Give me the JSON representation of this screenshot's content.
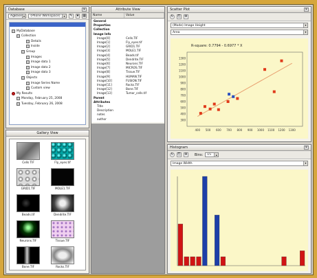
{
  "left_panel": {
    "title": "Database",
    "db_combo": "AgBase",
    "image_combo": "(Phone Workspace)"
  },
  "tree": {
    "items": [
      {
        "label": "MyDatabase",
        "level": 0
      },
      {
        "label": "Collection",
        "level": 1
      },
      {
        "label": "Details",
        "level": 3
      },
      {
        "label": "Inside",
        "level": 3
      },
      {
        "label": "Group",
        "level": 2
      },
      {
        "label": "Images",
        "level": 3
      },
      {
        "label": "Image data 1",
        "level": 3
      },
      {
        "label": "Image data 2",
        "level": 3
      },
      {
        "label": "Image data 3",
        "level": 3
      },
      {
        "label": "Objects",
        "level": 2
      },
      {
        "label": "Image Series Name",
        "level": 3
      },
      {
        "label": "Custom view",
        "level": 3
      },
      {
        "label": "My Results",
        "level": 0
      },
      {
        "label": "Monday, February 25, 2008",
        "level": 1
      },
      {
        "label": "Tuesday, February 26, 2008",
        "level": 1
      }
    ]
  },
  "gallery": {
    "title": "Gallery View",
    "items": [
      {
        "label": "Cells TIF",
        "style": "gray"
      },
      {
        "label": "Fly_eyes.tif",
        "style": "teal"
      },
      {
        "label": "GRID1.TIF",
        "style": "spots"
      },
      {
        "label": "MOLE1.TIF",
        "style": "black"
      },
      {
        "label": "Beads.tif",
        "style": "black2"
      },
      {
        "label": "Dendrite.TIF",
        "style": "micro"
      },
      {
        "label": "Neurons.TIF",
        "style": "neuron"
      },
      {
        "label": "Tissue.TIF",
        "style": "tissue"
      },
      {
        "label": "Bone.TIF",
        "style": "bone"
      },
      {
        "label": "Rocks.TIF",
        "style": "rocks"
      }
    ]
  },
  "metadata": {
    "title": "Attribute View",
    "col_name": "Name",
    "col_value": "Value",
    "rows": [
      {
        "name": "General",
        "value": "",
        "group": true
      },
      {
        "name": "Properties",
        "value": "",
        "group": true
      },
      {
        "name": "Collection",
        "value": "",
        "group": true
      },
      {
        "name": "Image Info",
        "value": "",
        "group": true
      },
      {
        "name": "Image[0]",
        "value": "Cells.TIF"
      },
      {
        "name": "Image[1]",
        "value": "Fly_eyes.tif"
      },
      {
        "name": "Image[2]",
        "value": "GRID1.TIF"
      },
      {
        "name": "Image[3]",
        "value": "MOLE1.TIF"
      },
      {
        "name": "Image[4]",
        "value": "Beads.tif"
      },
      {
        "name": "Image[5]",
        "value": "Dendrite.TIF"
      },
      {
        "name": "Image[6]",
        "value": "Neurons.TIF"
      },
      {
        "name": "Image[7]",
        "value": "MICROS.TIF"
      },
      {
        "name": "Image[8]",
        "value": "Tissue.TIF"
      },
      {
        "name": "Image[9]",
        "value": "HUMAN.TIF"
      },
      {
        "name": "Image[10]",
        "value": "FUSION.TIF"
      },
      {
        "name": "Image[11]",
        "value": "Rocks.TIF"
      },
      {
        "name": "Image[12]",
        "value": "Bone.TIF"
      },
      {
        "name": "Image[13]",
        "value": "Tumor_cells.tif"
      },
      {
        "name": "Parent",
        "value": "",
        "group": true
      },
      {
        "name": "Attributes",
        "value": "",
        "group": true
      },
      {
        "name": "Title",
        "value": ""
      },
      {
        "name": "Description",
        "value": ""
      },
      {
        "name": "notes",
        "value": ""
      },
      {
        "name": "author",
        "value": ""
      }
    ]
  },
  "scatter_panel": {
    "title": "Scatter Plot",
    "x_combo": "(Mode) Image Height",
    "y_combo": "Area",
    "chart_title": "R-square: 0.7794 - 0.6977 * X",
    "colors": {
      "point": "#e03a1a",
      "selected": "#2a4fbf",
      "line": "#e8a070"
    }
  },
  "histogram_panel": {
    "title": "Histogram",
    "combo": "Image Width",
    "bins_label": "Bins:",
    "bins_value": "15",
    "colors": {
      "bar_red": "#d01414",
      "bar_blue": "#1d3fa8"
    }
  },
  "chart_data": [
    {
      "type": "scatter",
      "title": "R-square: 0.7794 - 0.6977 * X",
      "xlim": [
        300,
        1400
      ],
      "ylim": [
        200,
        1400
      ],
      "x_ticks": [
        400,
        500,
        600,
        700,
        800,
        900,
        1000,
        1100,
        1200,
        1300
      ],
      "y_ticks": [
        300,
        400,
        500,
        600,
        700,
        800,
        900,
        1000,
        1100,
        1200,
        1300
      ],
      "series": [
        {
          "name": "",
          "x": [
            430,
            470,
            520,
            560,
            600,
            690,
            780,
            1040,
            1130,
            1200
          ],
          "y": [
            410,
            520,
            480,
            560,
            470,
            600,
            650,
            1120,
            760,
            1260
          ]
        },
        {
          "name": "",
          "x": [
            700,
            740
          ],
          "y": [
            720,
            680
          ]
        }
      ],
      "trendline": {
        "x": [
          400,
          1300
        ],
        "y": [
          360,
          1220
        ]
      }
    },
    {
      "type": "bar",
      "categories": [
        "",
        "",
        "",
        "",
        "",
        "",
        "",
        "",
        "",
        "",
        "",
        "",
        "",
        "",
        "",
        "",
        "",
        "",
        "",
        "",
        ""
      ],
      "values": [
        14,
        3,
        3,
        3,
        30,
        0,
        17,
        3,
        0,
        0,
        0,
        0,
        0,
        0,
        0,
        0,
        0,
        3,
        0,
        0,
        5
      ],
      "highlight": [
        false,
        false,
        false,
        false,
        true,
        false,
        true,
        false,
        false,
        false,
        false,
        false,
        false,
        false,
        false,
        false,
        false,
        false,
        false,
        false,
        false
      ],
      "ylim": [
        0,
        30
      ]
    }
  ]
}
